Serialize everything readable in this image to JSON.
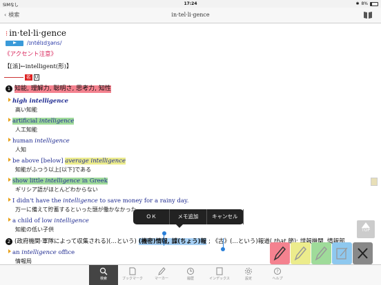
{
  "status_bar": {
    "carrier": "SIMなし",
    "time": "17:24",
    "battery": "8%"
  },
  "nav": {
    "back_label": "検索",
    "title": "in·tel·li·gence"
  },
  "entry": {
    "headword": "in·tel·li·gence",
    "pronunciation": "/ɪntélɪdʒəns/",
    "accent_note": "《アクセント注意》",
    "derivation": "【[派]←intelligent(形)】",
    "pos_tag": "名",
    "count_tag": "U",
    "sense1": {
      "num": "1",
      "text": "知能, 理解力, 聡明さ, 思考力, 知性"
    },
    "examples": [
      {
        "en_pre": "",
        "en_em": "high intelligence",
        "en_post": "",
        "ja": "高い知能"
      },
      {
        "en_pre": "artificial ",
        "en_em": "intelligence",
        "en_post": "",
        "ja": "人工知能"
      },
      {
        "en_pre": "human ",
        "en_em": "intelligence",
        "en_post": "",
        "ja": "人知"
      },
      {
        "en_pre": "be above [below] ",
        "en_em2": "average intelligence",
        "en_post": "",
        "ja": "知能がふつう以上[以下]である"
      },
      {
        "en_pre": "show little ",
        "en_em": "intelligence",
        "en_post": " in Greek",
        "ja": "ギリシア語がほとんどわからない"
      },
      {
        "en_pre": "I didn't have the ",
        "en_em": "intelligence",
        "en_post": " to save money for a rainy day.",
        "ja": "万一に備えて貯蓄するといった頭が働かなかった"
      },
      {
        "en_pre": "a child of low ",
        "en_em": "intelligence",
        "en_post": "",
        "ja": "知能の低い子供"
      }
    ],
    "sense2": {
      "num": "2",
      "pre": "(政府機関·軍隊によって収集される)(…という)",
      "selected": "(機密)情報, 諜(ちょう)報",
      "post": "; 《古》(…という)報道(",
      "that_label": "that",
      "tail": " 節); 諜報機関, 情報部"
    },
    "last_example": {
      "en_pre": "an ",
      "en_em": "intelligence",
      "en_post": " office",
      "ja": "情報局"
    }
  },
  "popup": {
    "ok": "ＯＫ",
    "add_memo": "メモ追加",
    "cancel": "キャンセル"
  },
  "top_button": "TOP",
  "pens": [
    {
      "name": "red",
      "color": "#f4828f"
    },
    {
      "name": "yellow",
      "color": "#ecec8c"
    },
    {
      "name": "green",
      "color": "#9fdb9a"
    },
    {
      "name": "blue",
      "color": "#8ec8ef"
    }
  ],
  "tabs": [
    {
      "label": "検索",
      "icon": "search-icon"
    },
    {
      "label": "ブックマーク",
      "icon": "bookmark-icon"
    },
    {
      "label": "マーカー",
      "icon": "marker-icon"
    },
    {
      "label": "履歴",
      "icon": "history-icon"
    },
    {
      "label": "インデックス",
      "icon": "index-icon"
    },
    {
      "label": "設定",
      "icon": "gear-icon"
    },
    {
      "label": "ヘルプ",
      "icon": "help-icon"
    }
  ]
}
